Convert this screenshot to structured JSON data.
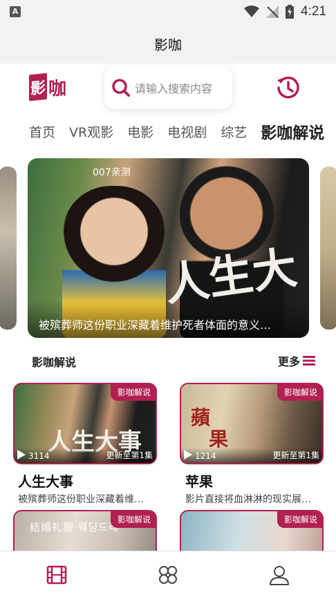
{
  "status_bar": {
    "time": "4:21",
    "left_icon": "A"
  },
  "app": {
    "title": "影咖"
  },
  "header": {
    "logo_char": "影",
    "logo_text": "咖",
    "search_placeholder": "请输入搜索内容",
    "history_icon": "history-icon"
  },
  "tabs": [
    {
      "label": "首页"
    },
    {
      "label": "VR观影"
    },
    {
      "label": "电影"
    },
    {
      "label": "电视剧"
    },
    {
      "label": "综艺"
    },
    {
      "label": "影咖解说",
      "active": true
    }
  ],
  "carousel": {
    "badge": "007亲测",
    "caption": "被殡葬师这份职业深藏着维护死者体面的意义…",
    "poster_text": "人生大"
  },
  "section": {
    "title": "影咖解说",
    "more_label": "更多"
  },
  "cards": [
    {
      "tag": "影咖解说",
      "plays": "3114",
      "episode": "更新至第1集",
      "title": "人生大事",
      "desc": "被殡葬师这份职业深藏着维…",
      "poster_text": "人生大事"
    },
    {
      "tag": "影咖解说",
      "plays": "1214",
      "episode": "更新至第1集",
      "title": "苹果",
      "desc": "影片直接将血淋淋的现实展…",
      "poster_text_1": "蘋",
      "poster_text_2": "果"
    },
    {
      "tag": "影咖解说",
      "poster_text": "结婚礼服 웨딩드레"
    },
    {
      "tag": "影咖解说"
    }
  ],
  "colors": {
    "accent": "#b0214f",
    "status_bg": "#f2f2f2"
  },
  "bottom_nav": [
    {
      "icon": "film-icon",
      "active": true
    },
    {
      "icon": "category-icon"
    },
    {
      "icon": "user-icon"
    }
  ]
}
